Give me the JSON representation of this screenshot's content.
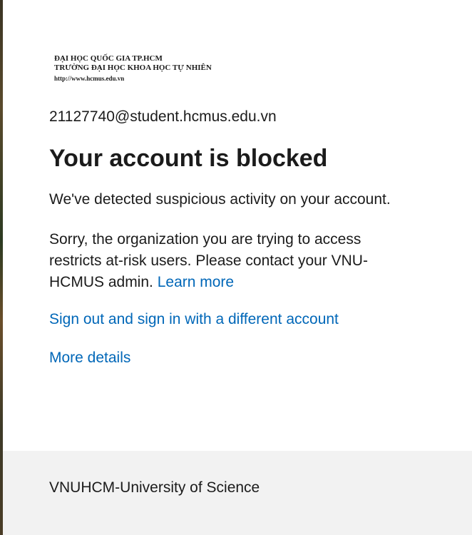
{
  "logo": {
    "line1": "ĐẠI HỌC QUỐC GIA TP.HCM",
    "line2": "TRƯỜNG ĐẠI HỌC KHOA HỌC TỰ NHIÊN",
    "url": "http://www.hcmus.edu.vn"
  },
  "identity": "21127740@student.hcmus.edu.vn",
  "title": "Your account is blocked",
  "message": {
    "detected": "We've detected suspicious activity on your account.",
    "body": "Sorry, the organization you are trying to access restricts at-risk users. Please contact your VNU-HCMUS admin.",
    "learn_more": "Learn more"
  },
  "links": {
    "sign_out": "Sign out and sign in with a different account",
    "more_details": "More details"
  },
  "footer": {
    "text": "VNUHCM-University of Science"
  },
  "colors": {
    "link": "#0067b8",
    "text": "#1b1b1b",
    "card_bg": "#ffffff",
    "footer_bg": "#f2f2f2"
  }
}
